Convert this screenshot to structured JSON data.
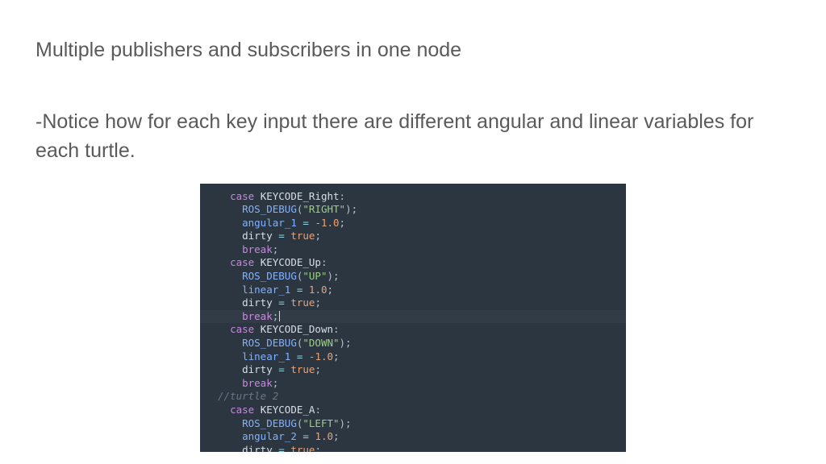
{
  "title": "Multiple publishers and subscribers in one node",
  "body": "-Notice how for each key input there are different angular and linear variables for each turtle.",
  "code": {
    "lines": [
      {
        "i": 1,
        "kw": "case",
        "id": "KEYCODE_Right",
        "colon": ":"
      },
      {
        "i": 2,
        "fn": "ROS_DEBUG",
        "p1": "(",
        "str": "\"RIGHT\"",
        "p2": ");"
      },
      {
        "i": 2,
        "var": "angular_1",
        "op": "=",
        "num": "-1.0",
        "sc": ";"
      },
      {
        "i": 2,
        "var": "dirty",
        "op": "=",
        "bool": "true",
        "sc": ";"
      },
      {
        "i": 2,
        "kw": "break",
        "sc": ";"
      },
      {
        "i": 1,
        "kw": "case",
        "id": "KEYCODE_Up",
        "colon": ":"
      },
      {
        "i": 2,
        "fn": "ROS_DEBUG",
        "p1": "(",
        "str": "\"UP\"",
        "p2": ");"
      },
      {
        "i": 2,
        "var": "linear_1",
        "op": "=",
        "num": "1.0",
        "sc": ";"
      },
      {
        "i": 2,
        "var": "dirty",
        "op": "=",
        "bool": "true",
        "sc": ";"
      },
      {
        "i": 2,
        "kw": "break",
        "sc": ";",
        "cursor": true
      },
      {
        "i": 1,
        "kw": "case",
        "id": "KEYCODE_Down",
        "colon": ":"
      },
      {
        "i": 2,
        "fn": "ROS_DEBUG",
        "p1": "(",
        "str": "\"DOWN\"",
        "p2": ");"
      },
      {
        "i": 2,
        "var": "linear_1",
        "op": "=",
        "num": "-1.0",
        "sc": ";"
      },
      {
        "i": 2,
        "var": "dirty",
        "op": "=",
        "bool": "true",
        "sc": ";"
      },
      {
        "i": 2,
        "kw": "break",
        "sc": ";"
      },
      {
        "i": 0,
        "cmt": "//turtle 2"
      },
      {
        "i": 1,
        "kw": "case",
        "id": "KEYCODE_A",
        "colon": ":"
      },
      {
        "i": 2,
        "fn": "ROS_DEBUG",
        "p1": "(",
        "str": "\"LEFT\"",
        "p2": ");"
      },
      {
        "i": 2,
        "var": "angular_2",
        "op": "=",
        "num": "1.0",
        "sc": ";"
      },
      {
        "i": 2,
        "var": "dirty",
        "op": "=",
        "bool": "true",
        "sc": ";"
      }
    ]
  }
}
